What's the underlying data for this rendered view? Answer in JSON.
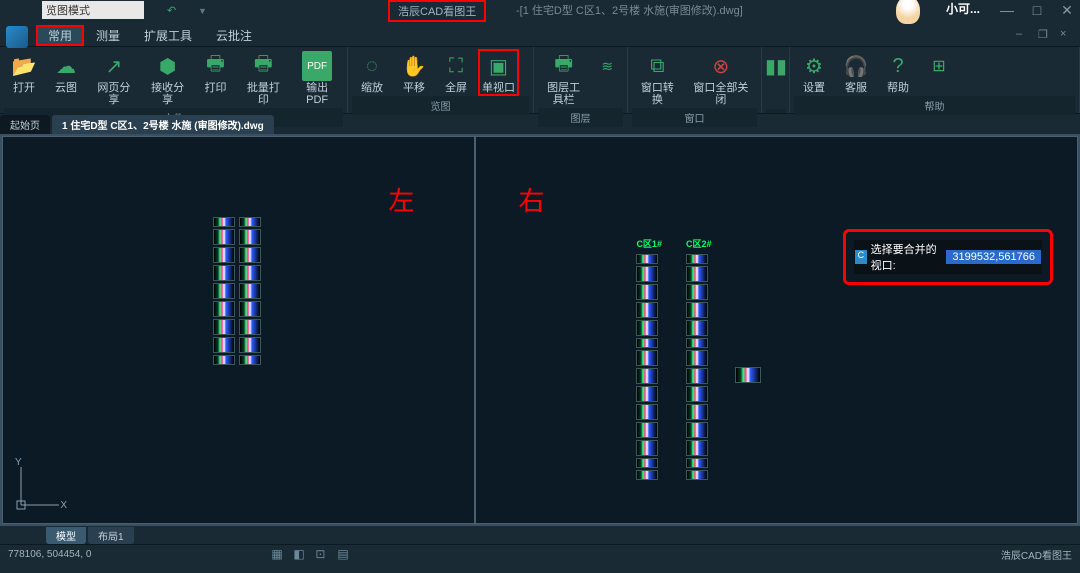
{
  "title_bar": {
    "mode": "览图模式",
    "app_name": "浩辰CAD看图王",
    "filename": "-[1 住宅D型  C区1、2号楼 水施(审图修改).dwg]",
    "user": "小可...",
    "min": "—",
    "max": "□",
    "close": "✕"
  },
  "menu": {
    "common": "常用",
    "measure": "测量",
    "extend": "扩展工具",
    "cloud": "云批注"
  },
  "ribbon": {
    "groups": {
      "file": "文件",
      "view": "览图",
      "layer": "图层",
      "window": "窗口",
      "help": "帮助"
    },
    "buttons": {
      "open": "打开",
      "cloud": "云图",
      "webshare": "网页分享",
      "recvshare": "接收分享",
      "print": "打印",
      "batchprint": "批量打印",
      "outpdf": "输出PDF",
      "zoom": "缩放",
      "pan": "平移",
      "fullscreen": "全屏",
      "singleview": "单视口",
      "layertools": "图层工具栏",
      "layerswitch": "窗口转换",
      "closeall": "窗口全部关闭",
      "settings": "设置",
      "service": "客服",
      "help": "帮助"
    }
  },
  "doc_tabs": {
    "start": "起始页",
    "file1": "1 住宅D型  C区1、2号楼 水施 (审图修改).dwg"
  },
  "viewport": {
    "left_label": "左",
    "right_label": "右",
    "bldg1": "C区1#",
    "bldg2": "C区2#",
    "prompt_text": "选择要合并的视口: ",
    "prompt_value": "3199532,561766",
    "ucs_y": "Y",
    "ucs_x": "X"
  },
  "layout_tabs": {
    "model": "模型",
    "layout1": "布局1"
  },
  "status": {
    "coords": "778106, 504454, 0",
    "brand": "浩辰CAD看图王"
  }
}
